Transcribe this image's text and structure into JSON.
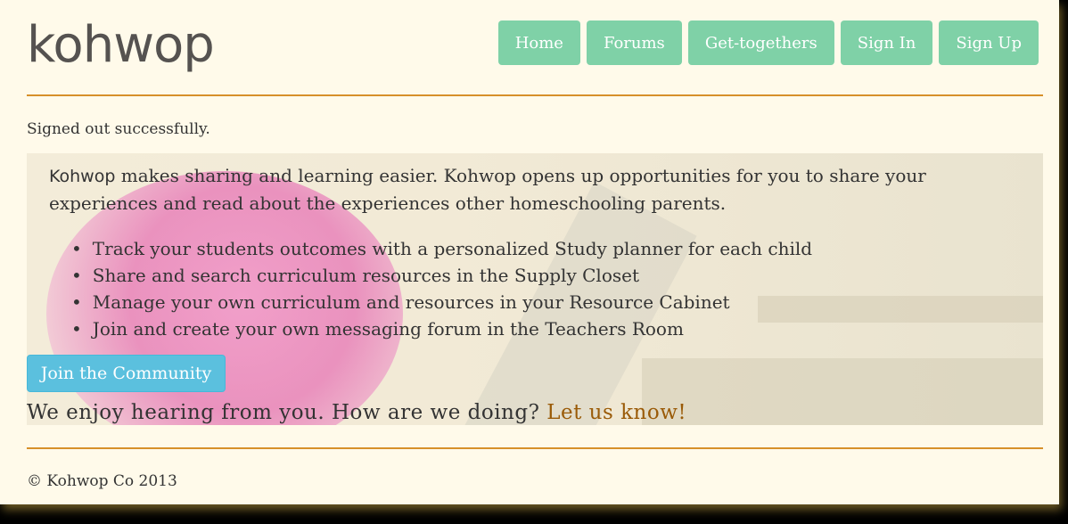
{
  "brand": {
    "logo": "kohwop"
  },
  "nav": {
    "items": [
      {
        "label": "Home"
      },
      {
        "label": "Forums"
      },
      {
        "label": "Get-togethers"
      },
      {
        "label": "Sign In"
      },
      {
        "label": "Sign Up"
      }
    ]
  },
  "colors": {
    "nav_button": "#7fd1a7",
    "join_button": "#5bc0de",
    "rule": "#d7902a",
    "link": "#9a5b08",
    "background": "#fffaea"
  },
  "flash": {
    "message": "Signed out successfully."
  },
  "hero": {
    "brand_word": "Kohwop",
    "intro_rest": " makes sharing and learning easier. Kohwop opens up opportunities for you to share your experiences and read about the experiences other homeschooling parents.",
    "features": [
      "Track your students outcomes with a personalized Study planner for each child",
      "Share and search curriculum resources in the Supply Closet",
      "Manage your own curriculum and resources in your Resource Cabinet",
      "Join and create your own messaging forum in the Teachers Room"
    ]
  },
  "cta": {
    "join_label": "Join the Community"
  },
  "feedback": {
    "question": "We enjoy hearing from you. How are we doing? ",
    "link_label": "Let us know!"
  },
  "footer": {
    "copyright": "© Kohwop Co 2013"
  }
}
